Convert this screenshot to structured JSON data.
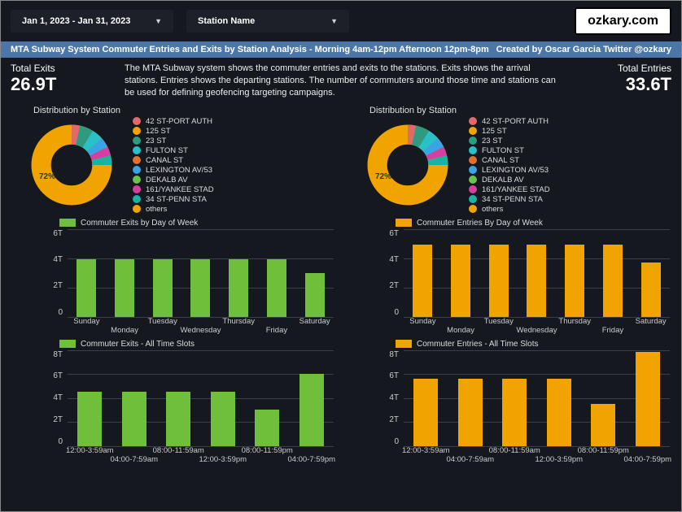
{
  "topbar": {
    "date_range": "Jan 1, 2023 - Jan 31, 2023",
    "station_label": "Station Name",
    "brand": "ozkary.com"
  },
  "bluebar": {
    "title": "MTA Subway System Commuter Entries and Exits by Station Analysis -  Morning 4am-12pm Afternoon 12pm-8pm",
    "credit": "Created by Oscar Garcia Twitter @ozkary"
  },
  "kpi_left": {
    "label": "Total Exits",
    "value": "26.9T"
  },
  "kpi_right": {
    "label": "Total Entries",
    "value": "33.6T"
  },
  "description": "The MTA Subway system shows the commuter entries and exits to the stations. Exits shows the arrival stations. Entries shows the departing stations. The number of commuters around those time and stations can be used for defining geofencing targeting campaigns.",
  "dist_title": "Distribution by Station",
  "donut_pct": "72%",
  "legend": [
    {
      "label": "42 ST-PORT AUTH",
      "color": "#e06a6a"
    },
    {
      "label": "125 ST",
      "color": "#f1a300"
    },
    {
      "label": "23 ST",
      "color": "#2e9b80"
    },
    {
      "label": "FULTON ST",
      "color": "#29c0c7"
    },
    {
      "label": "CANAL ST",
      "color": "#e07030"
    },
    {
      "label": "LEXINGTON AV/53",
      "color": "#3aa3e3"
    },
    {
      "label": "DEKALB AV",
      "color": "#6cc24a"
    },
    {
      "label": "161/YANKEE STAD",
      "color": "#d63ea2"
    },
    {
      "label": "34 ST-PENN STA",
      "color": "#18b3a3"
    },
    {
      "label": "others",
      "color": "#f1a300"
    }
  ],
  "charts": {
    "exits_dow": {
      "legend": "Commuter Exits by Day of Week"
    },
    "entries_dow": {
      "legend": "Commuter Entries By Day of Week"
    },
    "exits_slot": {
      "legend": "Commuter Exits - All Time Slots"
    },
    "entries_slot": {
      "legend": "Commuter Entries - All Time Slots"
    }
  },
  "chart_data": [
    {
      "type": "donut",
      "title": "Distribution by Station (Exits)",
      "categories": [
        "42 ST-PORT AUTH",
        "125 ST",
        "23 ST",
        "FULTON ST",
        "CANAL ST",
        "LEXINGTON AV/53",
        "DEKALB AV",
        "161/YANKEE STAD",
        "34 ST-PENN STA",
        "others"
      ],
      "values": [
        3,
        3,
        3,
        3,
        3,
        3,
        3,
        3,
        4,
        72
      ],
      "note": "Approximate percentages; 'others' slice labeled 72%"
    },
    {
      "type": "donut",
      "title": "Distribution by Station (Entries)",
      "categories": [
        "42 ST-PORT AUTH",
        "125 ST",
        "23 ST",
        "FULTON ST",
        "CANAL ST",
        "LEXINGTON AV/53",
        "DEKALB AV",
        "161/YANKEE STAD",
        "34 ST-PENN STA",
        "others"
      ],
      "values": [
        3,
        3,
        3,
        3,
        3,
        3,
        3,
        3,
        4,
        72
      ],
      "note": "Approximate percentages; 'others' slice labeled 72%"
    },
    {
      "type": "bar",
      "title": "Commuter Exits by Day of Week",
      "categories": [
        "Sunday",
        "Monday",
        "Tuesday",
        "Wednesday",
        "Thursday",
        "Friday",
        "Saturday"
      ],
      "values": [
        3.9,
        3.9,
        3.9,
        3.9,
        3.9,
        3.9,
        3.0
      ],
      "ylabel": "",
      "ylim": [
        0,
        6
      ],
      "yticks": [
        0,
        2,
        4,
        6
      ],
      "unit": "T",
      "color": "#6fbf3b"
    },
    {
      "type": "bar",
      "title": "Commuter Entries By Day of Week",
      "categories": [
        "Sunday",
        "Monday",
        "Tuesday",
        "Wednesday",
        "Thursday",
        "Friday",
        "Saturday"
      ],
      "values": [
        4.9,
        4.9,
        4.9,
        4.9,
        4.9,
        4.9,
        3.7
      ],
      "ylabel": "",
      "ylim": [
        0,
        6
      ],
      "yticks": [
        0,
        2,
        4,
        6
      ],
      "unit": "T",
      "color": "#f1a300"
    },
    {
      "type": "bar",
      "title": "Commuter Exits - All Time Slots",
      "categories": [
        "12:00-3:59am",
        "04:00-7:59am",
        "08:00-11:59am",
        "12:00-3:59pm",
        "08:00-11:59pm",
        "04:00-7:59pm"
      ],
      "values": [
        4.5,
        4.5,
        4.5,
        4.5,
        3.0,
        6.0
      ],
      "ylabel": "",
      "ylim": [
        0,
        8
      ],
      "yticks": [
        0,
        2,
        4,
        6,
        8
      ],
      "unit": "T",
      "color": "#6fbf3b"
    },
    {
      "type": "bar",
      "title": "Commuter Entries - All Time Slots",
      "categories": [
        "12:00-3:59am",
        "04:00-7:59am",
        "08:00-11:59am",
        "12:00-3:59pm",
        "08:00-11:59pm",
        "04:00-7:59pm"
      ],
      "values": [
        5.6,
        5.6,
        5.6,
        5.6,
        3.5,
        7.8
      ],
      "ylabel": "",
      "ylim": [
        0,
        8
      ],
      "yticks": [
        0,
        2,
        4,
        6,
        8
      ],
      "unit": "T",
      "color": "#f1a300"
    }
  ],
  "dow_labels": [
    "Sunday",
    "Monday",
    "Tuesday",
    "Wednesday",
    "Thursday",
    "Friday",
    "Saturday"
  ],
  "slot_labels": [
    "12:00-3:59am",
    "04:00-7:59am",
    "08:00-11:59am",
    "12:00-3:59pm",
    "08:00-11:59pm",
    "04:00-7:59pm"
  ],
  "dow_ticks": [
    "6T",
    "4T",
    "2T",
    "0"
  ],
  "slot_ticks": [
    "8T",
    "6T",
    "4T",
    "2T",
    "0"
  ]
}
